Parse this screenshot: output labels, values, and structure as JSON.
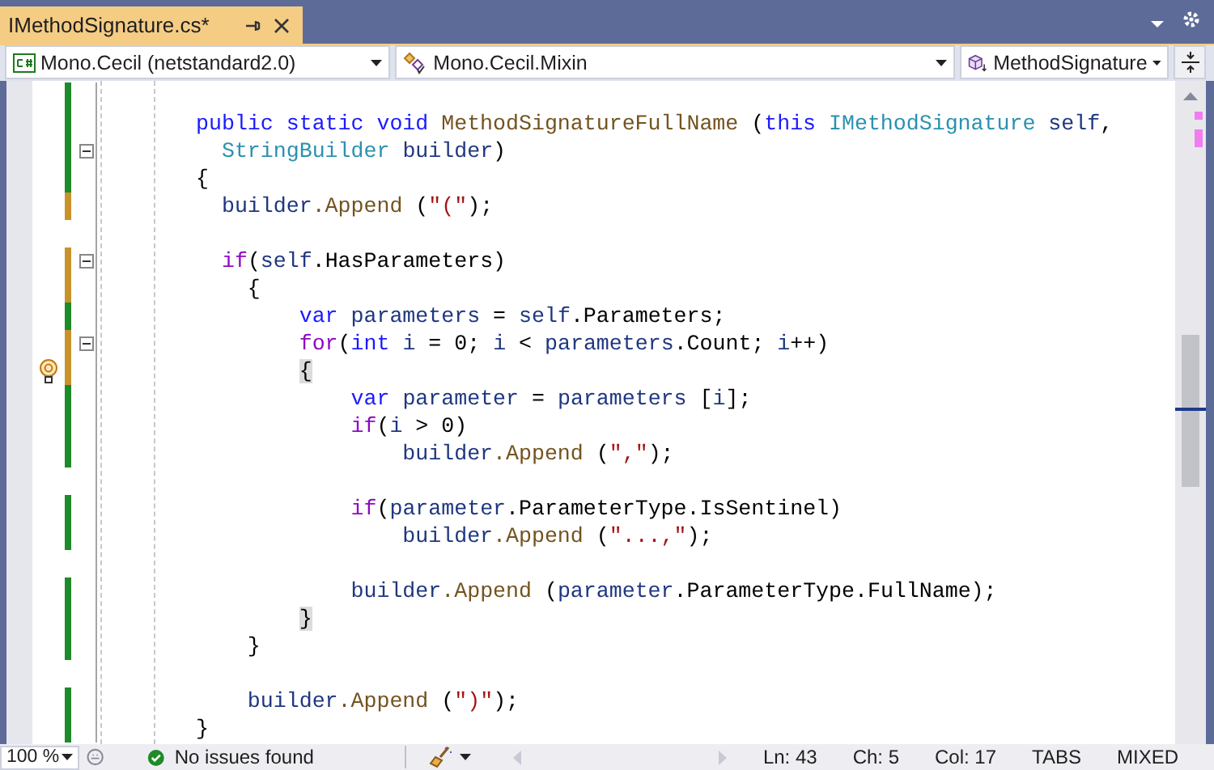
{
  "tab": {
    "title": "IMethodSignature.cs*",
    "selected": true
  },
  "nav": [
    {
      "kind": "project",
      "label": "Mono.Cecil (netstandard2.0)"
    },
    {
      "kind": "class",
      "label": "Mono.Cecil.Mixin"
    },
    {
      "kind": "member",
      "label": "MethodSignature"
    }
  ],
  "code_lines": [
    {
      "color": "#1e8a2a"
    },
    {
      "color": "#1e8a2a",
      "tokens": [
        {
          "kind": "kw",
          "text": "public static void "
        },
        {
          "kind": "method",
          "text": "MethodSignatureFullName"
        },
        {
          "kind": "plain",
          "text": " ("
        },
        {
          "kind": "kw",
          "text": "this "
        },
        {
          "kind": "type",
          "text": "IMethodSignature "
        },
        {
          "kind": "var",
          "text": "self"
        },
        {
          "kind": "plain",
          "text": ","
        }
      ]
    },
    {
      "color": "#1e8a2a",
      "collapsible": true,
      "tokens": [
        {
          "kind": "type",
          "text": "  StringBuilder "
        },
        {
          "kind": "var",
          "text": "builder"
        },
        {
          "kind": "plain",
          "text": ")"
        }
      ]
    },
    {
      "color": "#1e8a2a",
      "tokens": [
        {
          "kind": "plain",
          "text": "{"
        }
      ]
    },
    {
      "color": "#c8922a",
      "tokens": [
        {
          "kind": "var",
          "text": "  builder"
        },
        {
          "kind": "method",
          "text": ".Append"
        },
        {
          "kind": "plain",
          "text": " ("
        },
        {
          "kind": "str",
          "text": "\"(\""
        },
        {
          "kind": "plain",
          "text": ");"
        }
      ]
    },
    {
      "color": "#c8922a",
      "blank_before": true,
      "collapsible": true,
      "tokens": [
        {
          "kind": "ctl",
          "text": "  if"
        },
        {
          "kind": "plain",
          "text": "("
        },
        {
          "kind": "var",
          "text": "self"
        },
        {
          "kind": "plain",
          "text": ".HasParameters)"
        }
      ]
    },
    {
      "color": "#c8922a",
      "tokens": [
        {
          "kind": "plain",
          "text": "    {"
        }
      ]
    },
    {
      "color": "#1e8a2a",
      "tokens": [
        {
          "kind": "kw",
          "text": "        var "
        },
        {
          "kind": "var",
          "text": "parameters"
        },
        {
          "kind": "plain",
          "text": " = "
        },
        {
          "kind": "var",
          "text": "self"
        },
        {
          "kind": "plain",
          "text": ".Parameters;"
        }
      ]
    },
    {
      "color": "#c8922a",
      "collapsible": true,
      "tokens": [
        {
          "kind": "ctl",
          "text": "        for"
        },
        {
          "kind": "plain",
          "text": "("
        },
        {
          "kind": "kw",
          "text": "int "
        },
        {
          "kind": "var",
          "text": "i"
        },
        {
          "kind": "plain",
          "text": " = 0; "
        },
        {
          "kind": "var",
          "text": "i"
        },
        {
          "kind": "plain",
          "text": " < "
        },
        {
          "kind": "var",
          "text": "parameters"
        },
        {
          "kind": "plain",
          "text": ".Count; "
        },
        {
          "kind": "var",
          "text": "i"
        },
        {
          "kind": "plain",
          "text": "++)"
        }
      ]
    },
    {
      "color": "#c8922a",
      "hint": true,
      "tokens": [
        {
          "kind": "match",
          "text": "        {"
        }
      ]
    },
    {
      "color": "#1e8a2a",
      "tokens": [
        {
          "kind": "kw",
          "text": "            var "
        },
        {
          "kind": "var",
          "text": "parameter"
        },
        {
          "kind": "plain",
          "text": " = "
        },
        {
          "kind": "var",
          "text": "parameters"
        },
        {
          "kind": "plain",
          "text": " ["
        },
        {
          "kind": "var",
          "text": "i"
        },
        {
          "kind": "plain",
          "text": "];"
        }
      ]
    },
    {
      "color": "#1e8a2a",
      "tokens": [
        {
          "kind": "ctl",
          "text": "            if"
        },
        {
          "kind": "plain",
          "text": "("
        },
        {
          "kind": "var",
          "text": "i"
        },
        {
          "kind": "plain",
          "text": " > 0)"
        }
      ]
    },
    {
      "color": "#1e8a2a",
      "tokens": [
        {
          "kind": "var",
          "text": "                builder"
        },
        {
          "kind": "method",
          "text": ".Append"
        },
        {
          "kind": "plain",
          "text": " ("
        },
        {
          "kind": "str",
          "text": "\",\""
        },
        {
          "kind": "plain",
          "text": ");"
        }
      ]
    },
    {
      "color": "#1e8a2a",
      "blank_before": true,
      "tokens": [
        {
          "kind": "ctl",
          "text": "            if"
        },
        {
          "kind": "plain",
          "text": "("
        },
        {
          "kind": "var",
          "text": "parameter"
        },
        {
          "kind": "plain",
          "text": ".ParameterType.IsSentinel)"
        }
      ]
    },
    {
      "color": "#1e8a2a",
      "tokens": [
        {
          "kind": "var",
          "text": "                builder"
        },
        {
          "kind": "method",
          "text": ".Append"
        },
        {
          "kind": "plain",
          "text": " ("
        },
        {
          "kind": "str",
          "text": "\"...,\""
        },
        {
          "kind": "plain",
          "text": ");"
        }
      ]
    },
    {
      "color": "#1e8a2a",
      "blank_before": true,
      "tokens": [
        {
          "kind": "var",
          "text": "            builder"
        },
        {
          "kind": "method",
          "text": ".Append"
        },
        {
          "kind": "plain",
          "text": " ("
        },
        {
          "kind": "var",
          "text": "parameter"
        },
        {
          "kind": "plain",
          "text": ".ParameterType.FullName);"
        }
      ]
    },
    {
      "color": "#1e8a2a",
      "tokens": [
        {
          "kind": "match",
          "text": "        }"
        }
      ]
    },
    {
      "color": "#1e8a2a",
      "tokens": [
        {
          "kind": "plain",
          "text": "    }"
        }
      ]
    },
    {
      "color": "#1e8a2a",
      "blank_before": true,
      "tokens": [
        {
          "kind": "var",
          "text": "    builder"
        },
        {
          "kind": "method",
          "text": ".Append"
        },
        {
          "kind": "plain",
          "text": " ("
        },
        {
          "kind": "str",
          "text": "\")\""
        },
        {
          "kind": "plain",
          "text": ");"
        }
      ]
    },
    {
      "color": "#1e8a2a",
      "tokens": [
        {
          "kind": "plain",
          "text": "}"
        }
      ]
    }
  ],
  "status_bar": {
    "zoom": "100 %",
    "issues": "No issues found",
    "ln": "Ln: 43",
    "ch": "Ch: 5",
    "col": "Col: 17",
    "indent": "TABS",
    "eol": "MIXED"
  }
}
